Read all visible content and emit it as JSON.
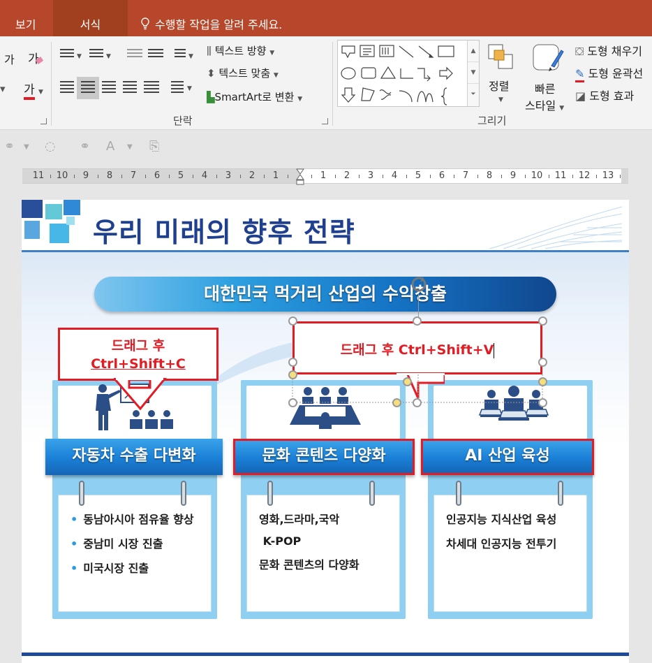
{
  "tabs": {
    "view": "보기",
    "format": "서식",
    "tell_me": "수행할 작업을 알려 주세요."
  },
  "ribbon": {
    "font_size_grow": "가",
    "font_size_shrink": "가",
    "font_color": "가",
    "text_direction": "텍스트 방향",
    "text_align": "텍스트 맞춤",
    "smartart": "SmartArt로 변환",
    "paragraph_group": "단락",
    "arrange": "정렬",
    "quick_styles_1": "빠른",
    "quick_styles_2": "스타일",
    "shape_fill": "도형 채우기",
    "shape_outline": "도형 윤곽선",
    "shape_effects": "도형 효과",
    "drawing_group": "그리기"
  },
  "ruler": {
    "left_numbers": [
      "11",
      "10",
      "9",
      "8",
      "7",
      "6",
      "5",
      "4",
      "3",
      "2",
      "1"
    ],
    "right_numbers": [
      "1",
      "2",
      "3",
      "4",
      "5",
      "6",
      "7",
      "8",
      "9",
      "10",
      "11",
      "12",
      "13"
    ]
  },
  "slide": {
    "title": "우리 미래의 향후 전략",
    "banner": "대한민국 먹거리 산업의 수익창출",
    "callout_left_line1": "드래그 후",
    "callout_left_line2": "Ctrl+Shift+C",
    "callout_right": "드래그 후  Ctrl+Shift+V",
    "columns": [
      {
        "label": "자동차 수출 다변화",
        "items": [
          "동남아시아 점유율 향상",
          "중남미 시장 진출",
          "미국시장 진출"
        ]
      },
      {
        "label": "문화 콘텐츠 다양화",
        "items": [
          "영화,드라마,국악",
          " K-POP",
          "문화 콘텐츠의 다양화"
        ]
      },
      {
        "label": "AI 산업 육성",
        "items": [
          "인공지능 지식산업 육성",
          "차세대 인공지능 전투기"
        ]
      }
    ]
  },
  "colors": {
    "accent_red": "#e31c23",
    "title_blue": "#1f3f8f",
    "ribbon_tab": "#b7472a"
  }
}
